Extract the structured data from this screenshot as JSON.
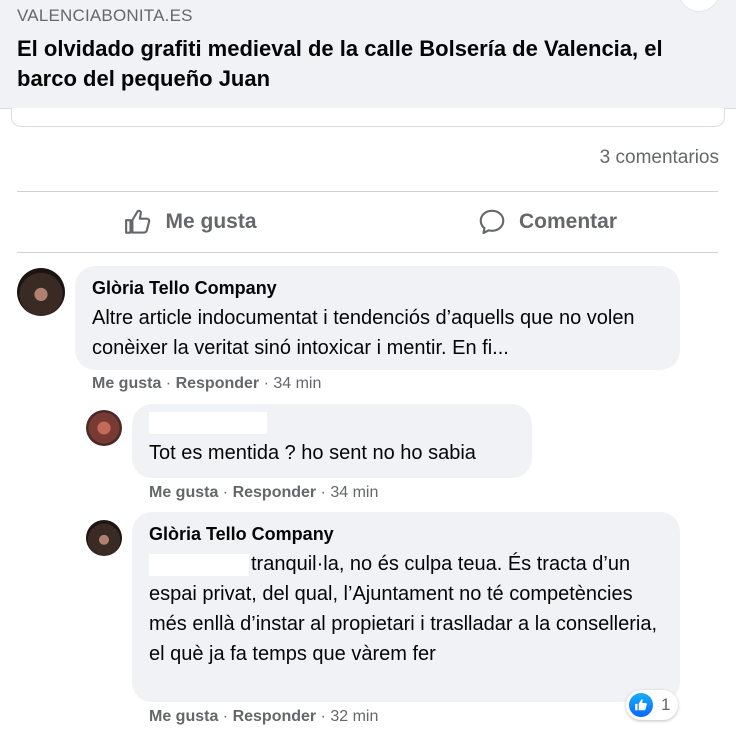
{
  "link": {
    "domain": "VALENCIABONITA.ES",
    "title": "El olvidado grafiti medieval de la calle Bolsería de Valencia, el barco del pequeño Juan"
  },
  "post": {
    "comment_count": "3 comentarios",
    "like_label": "Me gusta",
    "comment_label": "Comentar"
  },
  "comments": [
    {
      "author": "Glòria Tello Company",
      "text": "Altre article indocumentat i tendenciós d’aquells que no volen conèixer la veritat sinó intoxicar i mentir. En fi...",
      "like": "Me gusta",
      "reply": "Responder",
      "time": "34 min"
    },
    {
      "author": "",
      "text": "Tot es mentida ? ho sent no ho sabia",
      "like": "Me gusta",
      "reply": "Responder",
      "time": "34 min"
    },
    {
      "author": "Glòria Tello Company",
      "text": "tranquil·la, no és culpa teua. És tracta d’un espai privat, del qual, l’Ajuntament no té competències més enllà d’instar al propietari i traslladar a la conselleria, el què ja fa temps que vàrem fer",
      "like": "Me gusta",
      "reply": "Responder",
      "time": "32 min",
      "reaction_count": "1"
    }
  ],
  "colors": {
    "bubble": "#f0f2f5",
    "secondary_text": "#65676b",
    "like_blue": "#0866ff"
  }
}
